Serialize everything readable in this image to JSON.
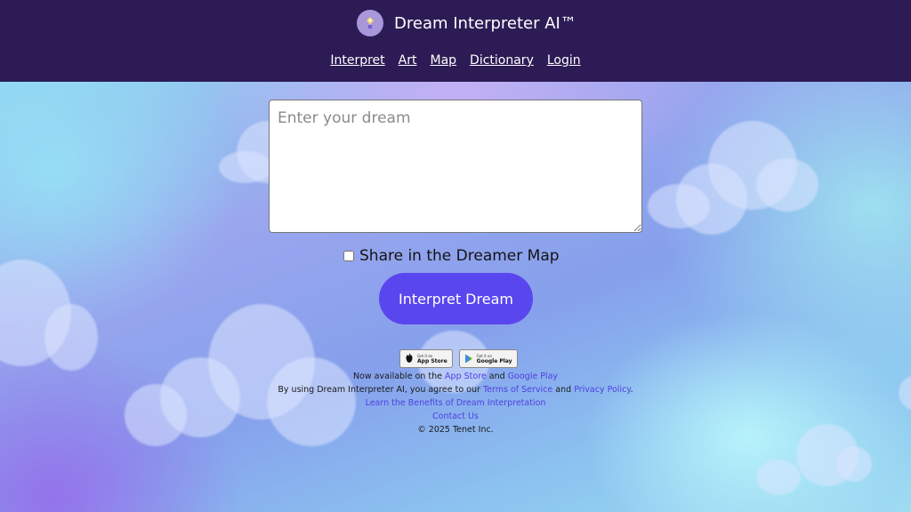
{
  "header": {
    "title": "Dream Interpreter AI™",
    "logo_icon": "lantern-icon",
    "nav": [
      "Interpret",
      "Art",
      "Map",
      "Dictionary",
      "Login"
    ]
  },
  "form": {
    "dream_placeholder": "Enter your dream",
    "share_label": "Share in the Dreamer Map",
    "submit_label": "Interpret Dream"
  },
  "stores": {
    "app_store": {
      "small": "Get it on",
      "big": "App Store",
      "icon": "apple-icon"
    },
    "google_play": {
      "small": "Get it on",
      "big": "Google Play",
      "icon": "google-play-icon"
    }
  },
  "footer": {
    "available_prefix": "Now available on the",
    "app_store_link": "App Store",
    "and": "and",
    "google_play_link": "Google Play",
    "terms_prefix": "By using Dream Interpreter AI, you agree to our",
    "terms_link": "Terms of Service",
    "and2": "and",
    "privacy_link": "Privacy Policy",
    "period": ".",
    "benefits_link": "Learn the Benefits of Dream Interpretation",
    "contact_link": "Contact Us",
    "copyright": "© 2025 Tenet Inc."
  },
  "colors": {
    "header_bg": "#2d1b55",
    "accent": "#5a46ee",
    "link": "#4f3fe0"
  }
}
